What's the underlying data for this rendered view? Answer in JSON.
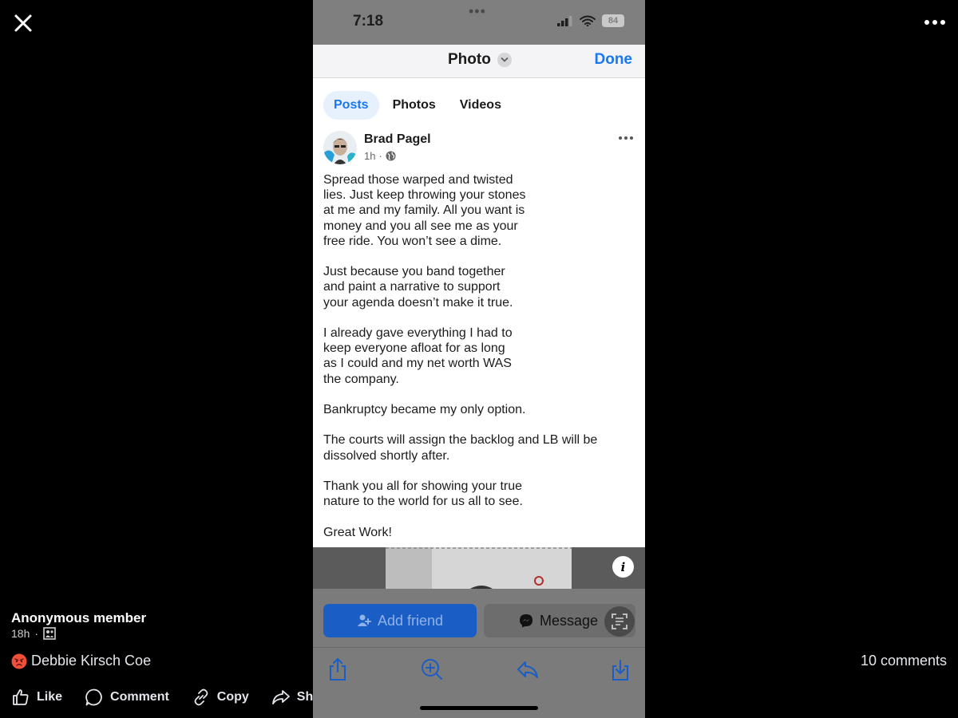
{
  "viewer": {
    "poster_name": "Anonymous member",
    "poster_time": "18h",
    "reaction_name": "Debbie Kirsch Coe",
    "comments_count": "10 comments",
    "actions": {
      "like": "Like",
      "comment": "Comment",
      "copy": "Copy",
      "share": "Share"
    }
  },
  "phone": {
    "status": {
      "time": "7:18",
      "battery": "84"
    },
    "nav": {
      "title": "Photo",
      "done": "Done"
    },
    "tabs": [
      {
        "label": "Posts",
        "active": true
      },
      {
        "label": "Photos",
        "active": false
      },
      {
        "label": "Videos",
        "active": false
      }
    ],
    "post": {
      "author": "Brad Pagel",
      "time": "1h",
      "lines": [
        [
          "Spread those warped and twisted",
          "lies. Just keep throwing your stones",
          "at me and my family. All you want is",
          "money and you all see me as your",
          "free ride. You won’t see a dime."
        ],
        [
          "Just because you band together",
          "and paint a narrative to support",
          "your agenda doesn’t make it true."
        ],
        [
          "I already gave everything I had to",
          "keep everyone afloat for as long",
          "as I could and my net worth WAS",
          "the company."
        ],
        [
          "Bankruptcy became my only option."
        ],
        [
          "The courts will assign the backlog and LB will be",
          "dissolved shortly after."
        ],
        [
          "Thank you all for showing your true",
          "nature to the world for us all to see."
        ],
        [
          "Great Work!"
        ]
      ]
    },
    "buttons": {
      "add_friend": "Add friend",
      "message": "Message"
    }
  },
  "colors": {
    "fb_blue": "#1877f2",
    "add_friend_bg": "#1a5dc4",
    "angry_reaction": "#f0503a"
  }
}
